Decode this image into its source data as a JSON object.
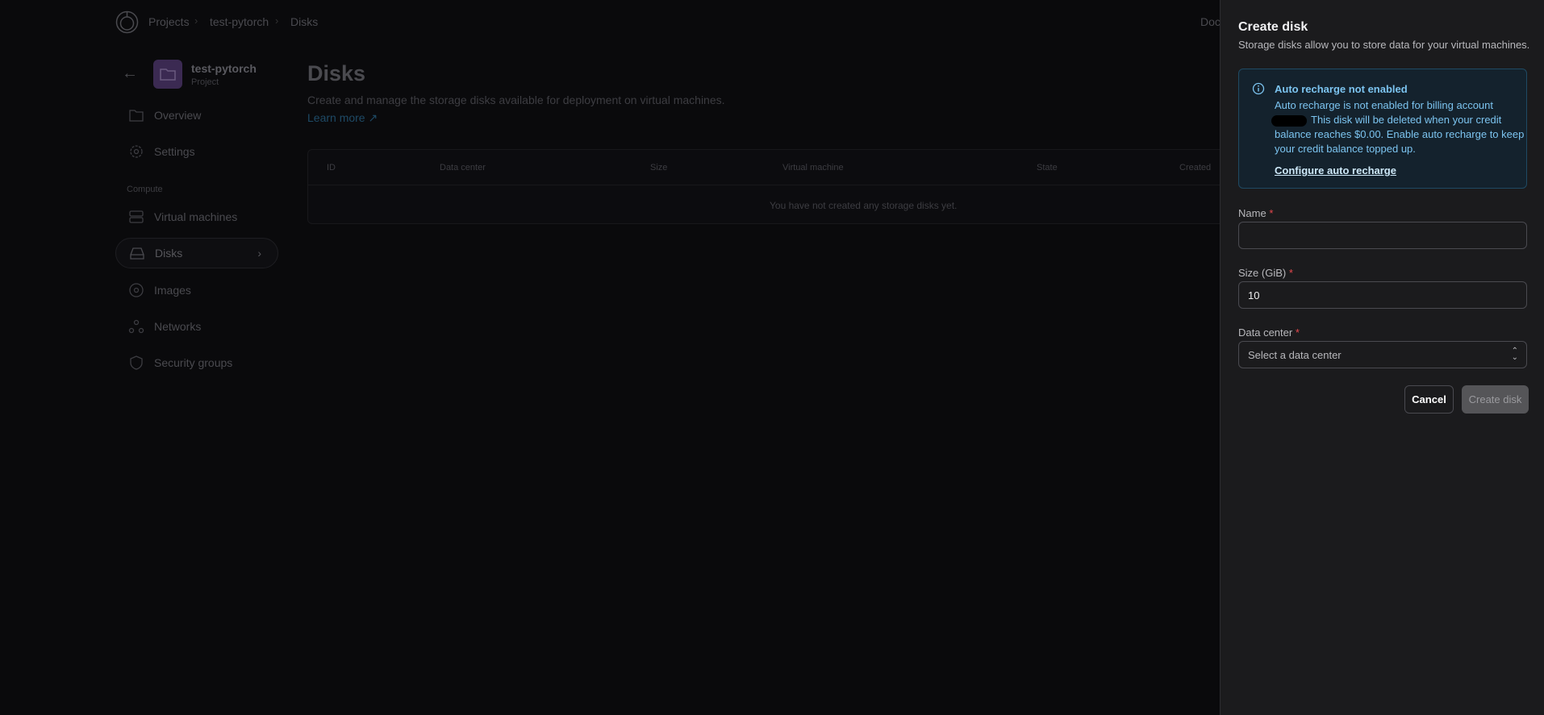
{
  "breadcrumb": [
    "Projects",
    "test-pytorch",
    "Disks"
  ],
  "header": {
    "docs_partial": "Docs"
  },
  "project": {
    "name": "test-pytorch",
    "type": "Project"
  },
  "sidebar": {
    "items": [
      {
        "label": "Overview",
        "icon": "folder-icon"
      },
      {
        "label": "Settings",
        "icon": "gear-icon"
      }
    ],
    "section": "Compute",
    "compute_items": [
      {
        "label": "Virtual machines",
        "icon": "server-icon"
      },
      {
        "label": "Disks",
        "icon": "disk-icon",
        "active": true
      },
      {
        "label": "Images",
        "icon": "disc-icon"
      },
      {
        "label": "Networks",
        "icon": "network-icon"
      },
      {
        "label": "Security groups",
        "icon": "shield-icon"
      }
    ]
  },
  "main": {
    "title": "Disks",
    "description": "Create and manage the storage disks available for deployment on virtual machines.",
    "learn_more": "Learn more",
    "table": {
      "columns": [
        "ID",
        "Data center",
        "Size",
        "Virtual machine",
        "State",
        "Created"
      ],
      "empty": "You have not created any storage disks yet."
    }
  },
  "drawer": {
    "title": "Create disk",
    "subtitle": "Storage disks allow you to store data for your virtual machines.",
    "alert": {
      "title": "Auto recharge not enabled",
      "line1": "Auto recharge is not enabled for billing account",
      "line2": "This disk will be deleted when your credit",
      "line3": "balance reaches $0.00. Enable auto recharge to keep",
      "line4": "your credit balance topped up.",
      "link": "Configure auto recharge"
    },
    "fields": {
      "name_label": "Name",
      "name_value": "",
      "size_label": "Size (GiB)",
      "size_value": "10",
      "dc_label": "Data center",
      "dc_placeholder": "Select a data center"
    },
    "cancel": "Cancel",
    "submit": "Create disk"
  },
  "colors": {
    "accent": "#7cc4f0",
    "alert_bg": "#14222d",
    "required": "#e5484d",
    "project_icon": "#3b2a52"
  }
}
